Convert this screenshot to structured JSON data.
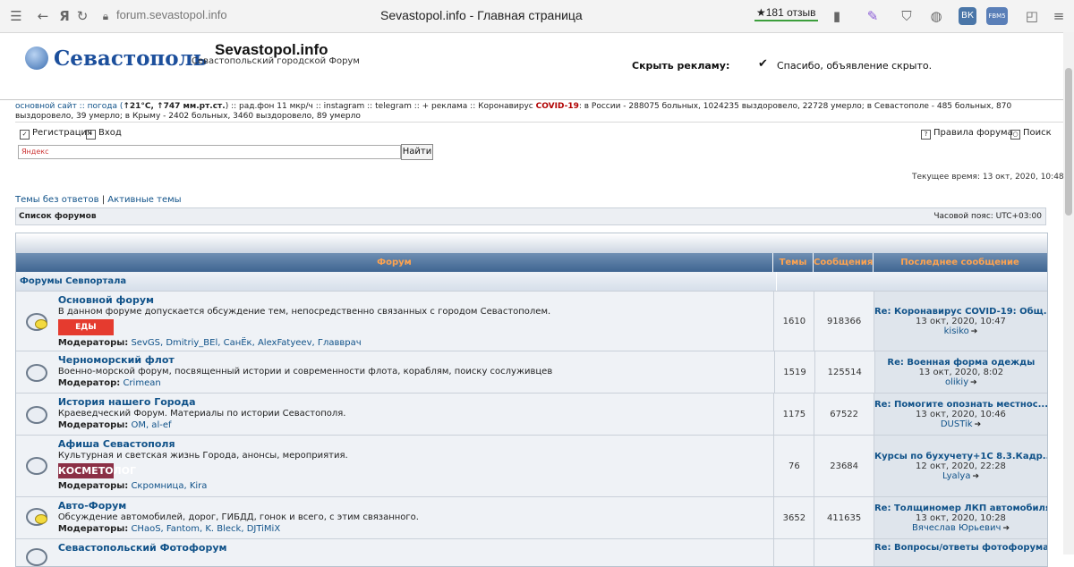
{
  "browser": {
    "url": "forum.sevastopol.info",
    "title": "Sevastopol.info - Главная страница",
    "reviews": "★181 отзыв",
    "ext_vk": "ВК",
    "ext_badge": "FBM5"
  },
  "header": {
    "logo_text": "Севастополь",
    "site_title": "Sevastopol.info",
    "site_subtitle": "Севастопольский городской Форум",
    "ad_hide_label": "Скрыть рекламу:",
    "ad_thanks": "Спасибо, объявление скрыто."
  },
  "ticker": {
    "part1": "основной сайт :: погода (",
    "temp": "↑21°C, ↑747 мм.рт.ст.",
    "part2": ") :: рад.фон 11 мкр/ч :: instagram :: telegram :: + реклама :: Коронавирус ",
    "covid": "COVID-19",
    "part3": ": в России - 288075 больных, 1024235 выздоровело, 22728 умерло; в Севастополе - 485 больных, 870 выздоровело, 39 умерло; в Крыму - 2402 больных, 3460 выздоровело, 89 умерло"
  },
  "nav": {
    "register": "Регистрация",
    "login": "Вход",
    "rules": "Правила форума",
    "search": "Поиск"
  },
  "search": {
    "placeholder": "Яндекс",
    "button": "Найти"
  },
  "current_time": "Текущее время: 13 окт, 2020, 10:48",
  "quick_links": {
    "unanswered": "Темы без ответов",
    "sep": " | ",
    "active": "Активные темы"
  },
  "forum_bar": {
    "list": "Список форумов",
    "timezone": "Часовой пояс: UTC+03:00"
  },
  "table": {
    "headers": [
      "Форум",
      "Темы",
      "Сообщения",
      "Последнее сообщение"
    ],
    "category": "Форумы Севпортала",
    "rows": [
      {
        "name": "Основной форум",
        "desc": "В данном форуме допускается обсуждение тем, непосредственно связанных с городом Севастополем.",
        "badge": "ЕДЫ",
        "mod_label": "Модераторы:",
        "mods": "SevGS, Dmitriy_BEl, СанЁк, AlexFatyeev, Главврач",
        "topics": "1610",
        "posts": "918366",
        "last_title": "Re: Коронавирус COVID-19: Общ...",
        "last_date": "13 окт, 2020, 10:47",
        "last_user": "kisiko"
      },
      {
        "name": "Черноморский флот",
        "desc": "Военно-морской форум, посвященный истории и современности флота, кораблям, поиску сослуживцев",
        "mod_label": "Модератор:",
        "mods": "Crimean",
        "topics": "1519",
        "posts": "125514",
        "last_title": "Re: Военная форма одежды",
        "last_date": "13 окт, 2020, 8:02",
        "last_user": "olikiy"
      },
      {
        "name": "История нашего Города",
        "desc": "Краеведческий Форум. Материалы по истории Севастополя.",
        "mod_label": "Модераторы:",
        "mods": "OM, al-ef",
        "topics": "1175",
        "posts": "67522",
        "last_title": "Re: Помогите опознать местнос...",
        "last_date": "13 окт, 2020, 10:46",
        "last_user": "DUSTik"
      },
      {
        "name": "Афиша Севастополя",
        "desc": "Культурная и светская жизнь Города, анонсы, мероприятия.",
        "badge": "КОСМЕТОЛОГ",
        "mod_label": "Модераторы:",
        "mods": "Скромница, Kira",
        "topics": "76",
        "posts": "23684",
        "last_title": "Курсы по бухучету+1С 8.3.Кадр...",
        "last_date": "12 окт, 2020, 22:28",
        "last_user": "Lyalya"
      },
      {
        "name": "Авто-Форум",
        "desc": "Обсуждение автомобилей, дорог, ГИБДД, гонок и всего, с этим связанного.",
        "mod_label": "Модераторы:",
        "mods": "CHaoS, Fantom, K. Bleck, DJTiMiX",
        "topics": "3652",
        "posts": "411635",
        "last_title": "Re: Толщиномер ЛКП автомобиля...",
        "last_date": "13 окт, 2020, 10:28",
        "last_user": "Вячеслав Юрьевич"
      },
      {
        "name": "Севастопольский Фотофорум",
        "last_title": "Re: Вопросы/ответы фотофорума."
      }
    ]
  }
}
